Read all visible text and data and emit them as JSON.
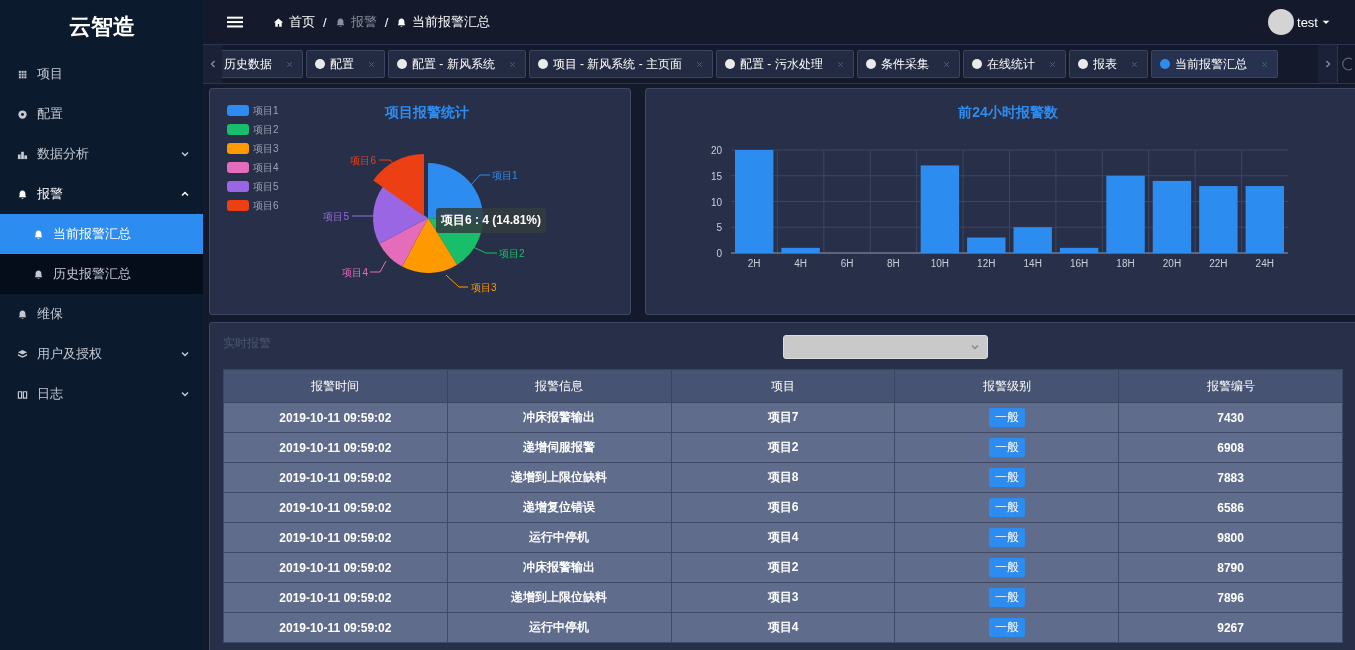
{
  "sidebar": {
    "logo": "云智造",
    "items": [
      {
        "label": "项目",
        "kind": "link"
      },
      {
        "label": "配置",
        "kind": "link"
      },
      {
        "label": "数据分析",
        "kind": "group",
        "expanded": false
      },
      {
        "label": "报警",
        "kind": "group",
        "expanded": true,
        "children": [
          {
            "label": "当前报警汇总",
            "selected": true
          },
          {
            "label": "历史报警汇总",
            "selected": false
          }
        ]
      },
      {
        "label": "维保",
        "kind": "link"
      },
      {
        "label": "用户及授权",
        "kind": "group",
        "expanded": false
      },
      {
        "label": "日志",
        "kind": "group",
        "expanded": false
      }
    ]
  },
  "header": {
    "breadcrumb": [
      {
        "label": "首页",
        "muted": false
      },
      {
        "label": "报警",
        "muted": true
      },
      {
        "label": "当前报警汇总",
        "muted": false
      }
    ],
    "separator": "/",
    "user": "test"
  },
  "tabs": [
    {
      "label": "历史数据",
      "selected": false
    },
    {
      "label": "配置",
      "selected": false
    },
    {
      "label": "配置 - 新风系统",
      "selected": false
    },
    {
      "label": "项目 - 新风系统 - 主页面",
      "selected": false
    },
    {
      "label": "配置 - 污水处理",
      "selected": false
    },
    {
      "label": "条件采集",
      "selected": false
    },
    {
      "label": "在线统计",
      "selected": false
    },
    {
      "label": "报表",
      "selected": false
    },
    {
      "label": "当前报警汇总",
      "selected": true
    }
  ],
  "pie_panel": {
    "title": "项目报警统计",
    "slices": [
      {
        "legend": "项目1",
        "label": "项目1",
        "color": "#2d8cf0"
      },
      {
        "legend": "项目2",
        "label": "项目2",
        "color": "#19be6b"
      },
      {
        "legend": "项目3",
        "label": "项目3",
        "color": "#ff9900"
      },
      {
        "legend": "项目4",
        "label": "项目4",
        "color": "#e46cbb"
      },
      {
        "legend": "项目5",
        "label": "项目5",
        "color": "#9a66e4"
      },
      {
        "legend": "项目6",
        "label": "项目6",
        "color": "#ed3f14"
      }
    ],
    "tooltip": "项目6 : 4 (14.81%)"
  },
  "bar_panel": {
    "chart_data": {
      "type": "bar",
      "title": "前24小时报警数",
      "categories": [
        "2H",
        "4H",
        "6H",
        "8H",
        "10H",
        "12H",
        "14H",
        "16H",
        "18H",
        "20H",
        "22H",
        "24H"
      ],
      "series": [
        {
          "color": "#2d8cf0",
          "values": [
            20,
            1,
            0,
            0,
            17,
            3,
            5,
            1,
            15,
            14,
            13,
            13
          ]
        }
      ],
      "grid": true,
      "ylim": [
        0,
        20
      ],
      "yticks": [
        0,
        5,
        10,
        15,
        20
      ]
    }
  },
  "alarms": {
    "title": "实时报警",
    "columns": [
      "报警时间",
      "报警信息",
      "项目",
      "报警级别",
      "报警编号"
    ],
    "rows": [
      [
        "2019-10-11 09:59:02",
        "冲床报警输出",
        "项目7",
        "一般",
        "7430"
      ],
      [
        "2019-10-11 09:59:02",
        "递增伺服报警",
        "项目2",
        "一般",
        "6908"
      ],
      [
        "2019-10-11 09:59:02",
        "递增到上限位缺料",
        "项目8",
        "一般",
        "7883"
      ],
      [
        "2019-10-11 09:59:02",
        "递增复位错误",
        "项目6",
        "一般",
        "6586"
      ],
      [
        "2019-10-11 09:59:02",
        "运行中停机",
        "项目4",
        "一般",
        "9800"
      ],
      [
        "2019-10-11 09:59:02",
        "冲床报警输出",
        "项目2",
        "一般",
        "8790"
      ],
      [
        "2019-10-11 09:59:02",
        "递增到上限位缺料",
        "项目3",
        "一般",
        "7896"
      ],
      [
        "2019-10-11 09:59:02",
        "运行中停机",
        "项目4",
        "一般",
        "9267"
      ]
    ]
  }
}
